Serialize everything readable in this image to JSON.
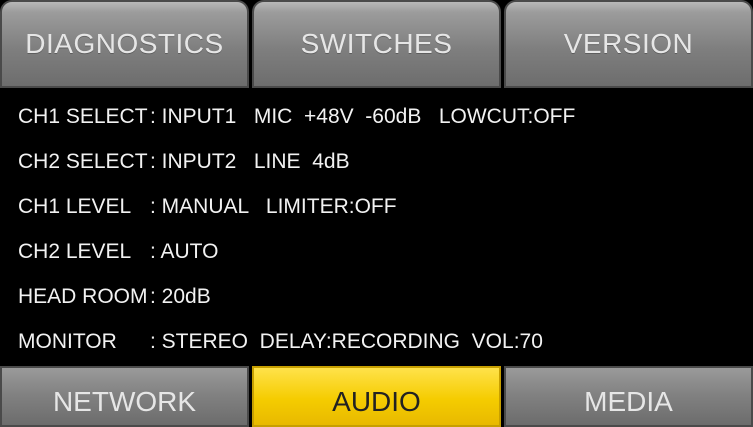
{
  "top_tabs": [
    {
      "label": "DIAGNOSTICS"
    },
    {
      "label": "SWITCHES"
    },
    {
      "label": "VERSION"
    }
  ],
  "rows": [
    {
      "label": "CH1 SELECT",
      "value": ": INPUT1   MIC  +48V  -60dB   LOWCUT:OFF"
    },
    {
      "label": "CH2 SELECT",
      "value": ": INPUT2   LINE  4dB"
    },
    {
      "label": "CH1 LEVEL",
      "value": ": MANUAL   LIMITER:OFF"
    },
    {
      "label": "CH2 LEVEL",
      "value": ": AUTO"
    },
    {
      "label": "HEAD ROOM",
      "value": ": 20dB"
    },
    {
      "label": "MONITOR",
      "value": ": STEREO  DELAY:RECORDING  VOL:70"
    }
  ],
  "bottom_tabs": [
    {
      "label": "NETWORK"
    },
    {
      "label": "AUDIO",
      "active": true
    },
    {
      "label": "MEDIA"
    }
  ],
  "colors": {
    "active_tab": "#f5cc00",
    "tab_gray": "#828282",
    "background": "#000000",
    "text": "#f2f2f2"
  }
}
